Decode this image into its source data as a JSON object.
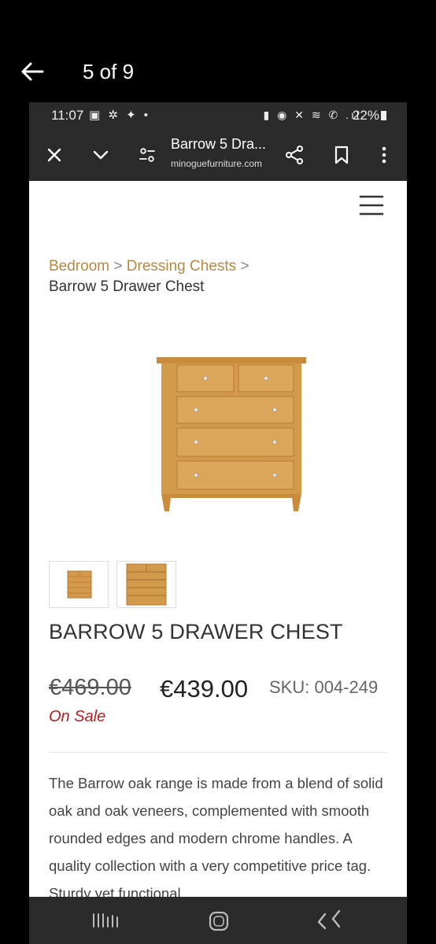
{
  "viewer": {
    "counter": "5 of 9"
  },
  "status_bar": {
    "time": "11:07",
    "left_icons": "▣ ✲ ✦ •",
    "right_icons": "▮ ◉ ✕ ≋ ✆ .ıl",
    "battery": "22%"
  },
  "browser": {
    "title": "Barrow 5 Dra...",
    "domain": "minoguefurniture.com"
  },
  "breadcrumb": {
    "items": [
      "Bedroom",
      "Dressing Chests"
    ],
    "separator": ">",
    "current": "Barrow 5 Drawer Chest"
  },
  "product": {
    "title": "BARROW 5 DRAWER CHEST",
    "old_price": "€469.00",
    "price": "€439.00",
    "sku": "SKU: 004-249",
    "sale_label": "On Sale",
    "description": "The Barrow oak range is made from a blend of solid oak and oak veneers, complemented with smooth rounded edges and modern chrome handles. A quality collection with a very competitive price tag. Sturdy yet functional"
  },
  "colors": {
    "breadcrumb_link": "#b58a3f",
    "sale": "#b22222",
    "chrome": "#2a2a2a",
    "oak": "#d49a4c"
  }
}
